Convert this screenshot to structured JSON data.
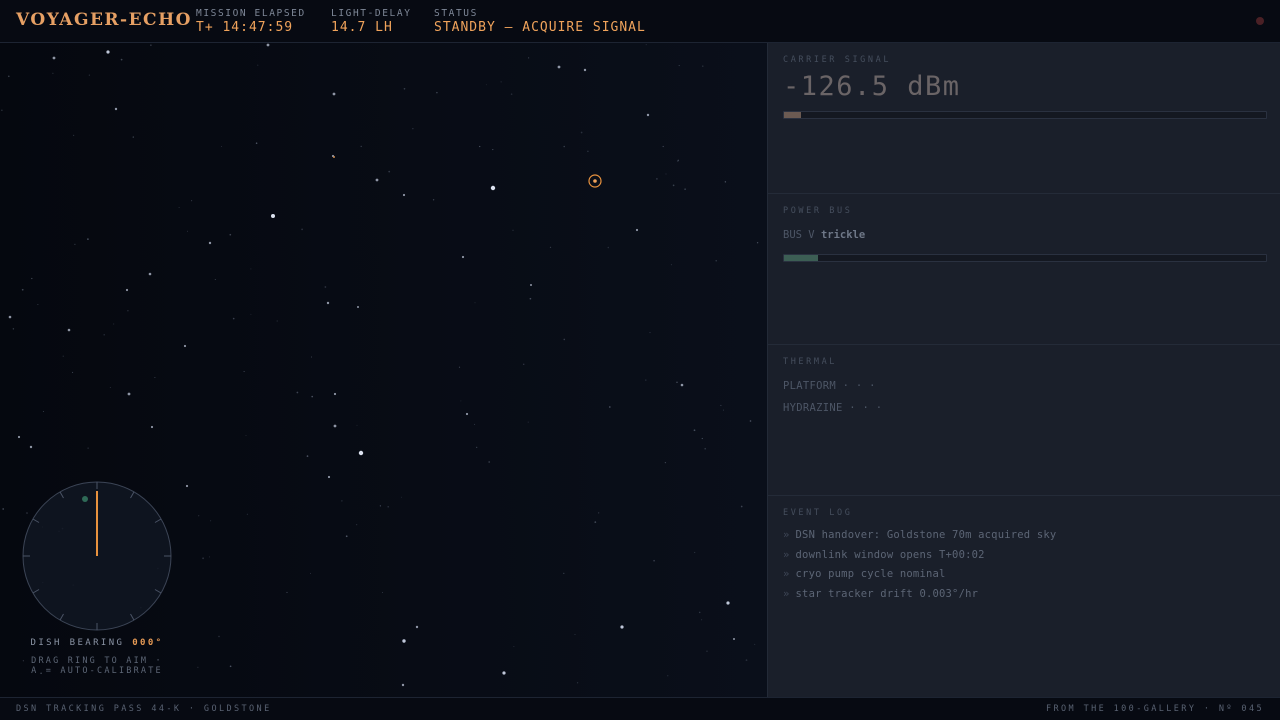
{
  "header": {
    "brand": "VOYAGER-ECHO",
    "mission_elapsed": {
      "label": "MISSION ELAPSED",
      "value": "T+ 14:47:59"
    },
    "light_delay": {
      "label": "LIGHT-DELAY",
      "value": "14.7 LH"
    },
    "status": {
      "label": "STATUS",
      "value": "STANDBY — ACQUIRE SIGNAL"
    }
  },
  "dial": {
    "bearing_label": "DISH BEARING",
    "bearing_value": "000°",
    "hint_line1": "DRAG RING TO AIM ·",
    "hint_line2": "A = AUTO-CALIBRATE"
  },
  "panel": {
    "carrier": {
      "title": "CARRIER SIGNAL",
      "value": "-126.5 dBm",
      "level": 0.035
    },
    "power": {
      "title": "POWER BUS",
      "label": "BUS V",
      "value": "trickle",
      "level": 0.07
    },
    "thermal": {
      "title": "THERMAL",
      "platform": "PLATFORM · · ·",
      "hydrazine": "HYDRAZINE · · ·"
    },
    "log": {
      "title": "EVENT LOG",
      "entries": [
        "DSN handover: Goldstone 70m acquired sky",
        "downlink window opens T+00:02",
        "cryo pump cycle nominal",
        "star tracker drift 0.003°/hr"
      ]
    }
  },
  "footer": {
    "left": "DSN TRACKING PASS 44-K · GOLDSTONE",
    "right": "FROM THE 100-GALLERY · Nº 045"
  },
  "colors": {
    "accent": "#f0a35b",
    "carrier_fill": "#6b5a52",
    "power_fill": "#3c5e54",
    "reticle": "#e8923e"
  }
}
